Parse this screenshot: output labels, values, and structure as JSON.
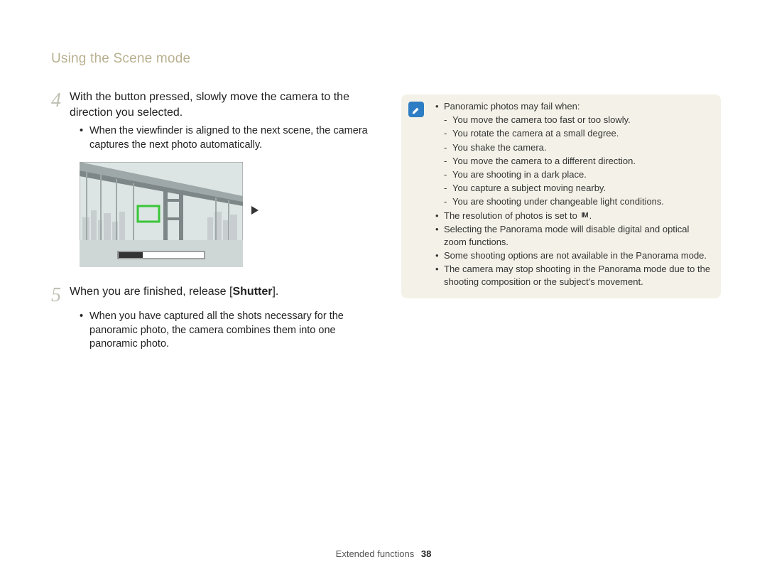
{
  "page_title": "Using the Scene mode",
  "steps": {
    "s4": {
      "num": "4",
      "text_a": "With the button pressed, slowly move the camera to the direction you selected.",
      "bullet": "When the viewfinder is aligned to the next scene, the camera captures the next photo automatically."
    },
    "s5": {
      "num": "5",
      "text_plain_a": "When you are finished, release [",
      "text_bold": "Shutter",
      "text_plain_b": "].",
      "bullet": "When you have captured all the shots necessary for the panoramic photo, the camera combines them into one panoramic photo."
    }
  },
  "note": {
    "b1": "Panoramic photos may fail when:",
    "d1": "You move the camera too fast or too slowly.",
    "d2": "You rotate the camera at a small degree.",
    "d3": "You shake the camera.",
    "d4": "You move the camera to a different direction.",
    "d5": "You are shooting in a dark place.",
    "d6": "You capture a subject moving nearby.",
    "d7": "You are shooting under changeable light conditions.",
    "b2a": "The resolution of photos is set to ",
    "b2b": ".",
    "b3": "Selecting the Panorama mode will disable digital and optical zoom functions.",
    "b4": "Some shooting options are not available in the Panorama mode.",
    "b5": "The camera may stop shooting in the Panorama mode due to the shooting composition or the subject's movement."
  },
  "footer": {
    "section": "Extended functions",
    "page": "38"
  },
  "icons": {
    "resolution": "IM"
  }
}
